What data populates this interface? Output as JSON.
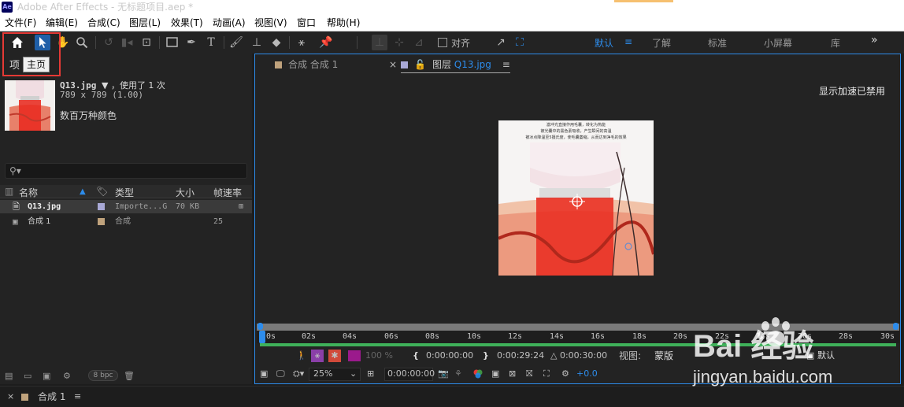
{
  "window": {
    "title": "Adobe After Effects - 无标题项目.aep *",
    "logo_text": "Ae"
  },
  "menu": [
    "文件(F)",
    "编辑(E)",
    "合成(C)",
    "图层(L)",
    "效果(T)",
    "动画(A)",
    "视图(V)",
    "窗口",
    "帮助(H)"
  ],
  "toolbar": {
    "align_label": "对齐",
    "workspaces": [
      "默认",
      "了解",
      "标准",
      "小屏幕",
      "库"
    ],
    "more": "»"
  },
  "project": {
    "tab_label": "项",
    "tooltip": "主页",
    "footage_name": "Q13.jpg",
    "footage_usage": "▼ ，使用了 1 次",
    "footage_dims": "789 x 789 (1.00)",
    "footage_colors": "数百万种颜色",
    "columns": {
      "name": "名称",
      "type": "类型",
      "size": "大小",
      "fps": "帧速率"
    },
    "items": [
      {
        "name": "Q13.jpg",
        "type": "Importe...G",
        "size": "70 KB",
        "fps": "",
        "color": "#a9a9d6"
      },
      {
        "name": "合成 1",
        "type": "合成",
        "size": "",
        "fps": "25",
        "color": "#bfa27c"
      }
    ],
    "bpc": "8 bpc"
  },
  "viewer": {
    "tab_comp": "合成",
    "tab_comp_name": "合成 1",
    "tab_layer": "图层",
    "tab_layer_name": "Q13.jpg",
    "accel_msg": "显示加速已禁用",
    "image_captions": [
      "激冲光直接作用毛囊，转化为热能",
      "被光囊中的黑色素吸收，产生瞬间的高温",
      "被冰点降温至5摄氏度，使毛囊萎缩，从而达到净毛的效果"
    ],
    "ruler_ticks": [
      "0s",
      "02s",
      "04s",
      "06s",
      "08s",
      "10s",
      "12s",
      "14s",
      "16s",
      "18s",
      "20s",
      "22s",
      "24s",
      "26s",
      "28s",
      "30s"
    ],
    "in_time": "0:00:00:00",
    "out_time": "0:00:29:24",
    "duration": "△ 0:00:30:00",
    "view_label": "视图:",
    "view_mode": "蒙版",
    "opacity": "100 %",
    "zoom": "25%",
    "current_time": "0:00:00:00",
    "exposure": "+0.0",
    "trailing_value": "默认"
  },
  "timeline": {
    "tab_label": "合成 1"
  },
  "watermark": {
    "brand": "Bai 经验",
    "url": "jingyan.baidu.com"
  }
}
